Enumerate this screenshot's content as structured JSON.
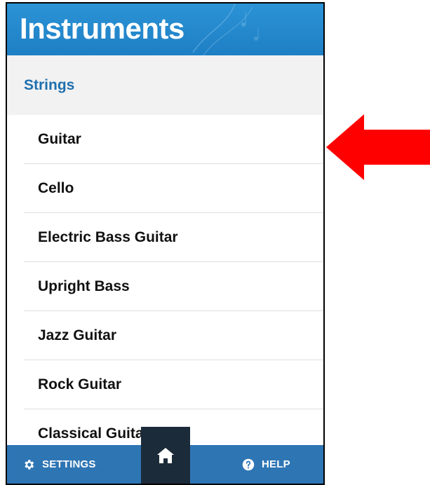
{
  "header": {
    "title": "Instruments"
  },
  "section": {
    "label": "Strings"
  },
  "list": {
    "items": [
      {
        "label": "Guitar"
      },
      {
        "label": "Cello"
      },
      {
        "label": "Electric Bass Guitar"
      },
      {
        "label": "Upright Bass"
      },
      {
        "label": "Jazz Guitar"
      },
      {
        "label": "Rock Guitar"
      },
      {
        "label": "Classical Guitar"
      }
    ]
  },
  "bottom_bar": {
    "settings_label": "SETTINGS",
    "settings_icon": "gear-icon",
    "home_icon": "home-icon",
    "help_label": "HELP",
    "help_icon": "question-circle-icon"
  },
  "annotation": {
    "arrow": "red-arrow-pointing-left",
    "arrow_color": "#ff0000"
  },
  "colors": {
    "header_blue": "#2b93d6",
    "section_text": "#1f6fae",
    "bottom_bar": "#2e75b4",
    "home_button": "#1c2b3a"
  }
}
